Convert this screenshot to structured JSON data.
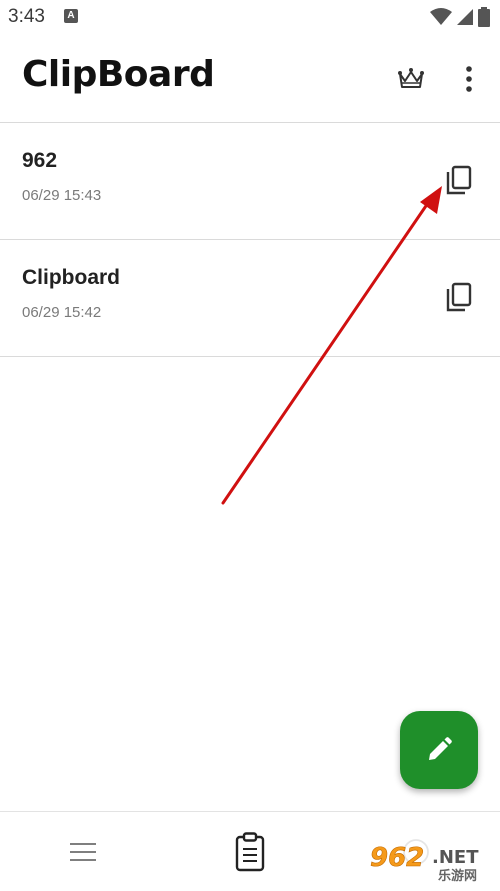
{
  "status_bar": {
    "time": "3:43",
    "notification_letter": "A"
  },
  "app_bar": {
    "title": "ClipBoard",
    "crown_icon": "crown-icon",
    "more_icon": "more-vert-icon"
  },
  "clips": [
    {
      "text": "962",
      "time": "06/29 15:43"
    },
    {
      "text": "Clipboard",
      "time": "06/29 15:42"
    }
  ],
  "fab": {
    "icon": "pencil-icon",
    "color": "#1f8f2a"
  },
  "bottom_nav": {
    "items": [
      "menu-icon",
      "clipboard-icon",
      "other-icon"
    ]
  },
  "watermark": {
    "text_a": "962",
    "text_b": ".NET",
    "text_c": "乐游网"
  },
  "colors": {
    "accent": "#1f8f2a",
    "annotation_arrow": "#d01010"
  }
}
